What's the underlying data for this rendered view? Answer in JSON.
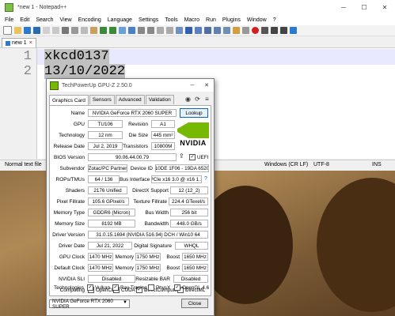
{
  "notepad": {
    "title": "*new 1 - Notepad++",
    "menu": [
      "File",
      "Edit",
      "Search",
      "View",
      "Encoding",
      "Language",
      "Settings",
      "Tools",
      "Macro",
      "Run",
      "Plugins",
      "Window",
      "?"
    ],
    "tab_label": "new 1",
    "tab_close": "×",
    "lines": [
      {
        "num": "1",
        "text": "xkcd0137"
      },
      {
        "num": "2",
        "text": "13/10/2022"
      }
    ],
    "status": {
      "left": "Normal text file",
      "eol": "Windows (CR LF)",
      "encoding": "UTF-8",
      "ins": "INS"
    }
  },
  "gpuz": {
    "title": "TechPowerUp GPU-Z 2.50.0",
    "tabs": [
      "Graphics Card",
      "Sensors",
      "Advanced",
      "Validation"
    ],
    "lookup": "Lookup",
    "rows": {
      "name": {
        "label": "Name",
        "value": "NVIDIA GeForce RTX 2060 SUPER"
      },
      "gpu": {
        "label": "GPU",
        "value": "TU106"
      },
      "revision": {
        "label": "Revision",
        "value": "A1"
      },
      "technology": {
        "label": "Technology",
        "value": "12 nm"
      },
      "die_size": {
        "label": "Die Size",
        "value": "445 mm²"
      },
      "release_date": {
        "label": "Release Date",
        "value": "Jul 2, 2019"
      },
      "transistors": {
        "label": "Transistors",
        "value": "10800M"
      },
      "bios": {
        "label": "BIOS Version",
        "value": "90.06.44.00.79"
      },
      "uefi": "UEFI",
      "subvendor": {
        "label": "Subvendor",
        "value": "Zotac/PC Partner"
      },
      "device_id": {
        "label": "Device ID",
        "value": "10DE 1F06 - 19DA 6520"
      },
      "rops": {
        "label": "ROPs/TMUs",
        "value": "64 / 136"
      },
      "bus_interface": {
        "label": "Bus Interface",
        "value": "PCIe x16 3.0 @ x16 1.1"
      },
      "bus_help": "?",
      "shaders": {
        "label": "Shaders",
        "value": "2176 Unified"
      },
      "directx": {
        "label": "DirectX Support",
        "value": "12 (12_2)"
      },
      "pixel_fillrate": {
        "label": "Pixel Fillrate",
        "value": "105.6 GPixel/s"
      },
      "texture_fillrate": {
        "label": "Texture Fillrate",
        "value": "224.4 GTexel/s"
      },
      "memory_type": {
        "label": "Memory Type",
        "value": "GDDR6 (Micron)"
      },
      "bus_width": {
        "label": "Bus Width",
        "value": "256 bit"
      },
      "memory_size": {
        "label": "Memory Size",
        "value": "8192 MB"
      },
      "bandwidth": {
        "label": "Bandwidth",
        "value": "448.0 GB/s"
      },
      "driver_version": {
        "label": "Driver Version",
        "value": "31.0.15.1694 (NVIDIA 516.94) DCH / Win10 64"
      },
      "driver_date": {
        "label": "Driver Date",
        "value": "Jul 21, 2022"
      },
      "digital_signature": {
        "label": "Digital Signature",
        "value": "WHQL"
      },
      "gpu_clock": {
        "label": "GPU Clock",
        "value": "1470 MHz",
        "mem_label": "Memory",
        "mem_value": "1750 MHz",
        "boost_label": "Boost",
        "boost_value": "1650 MHz"
      },
      "default_clock": {
        "label": "Default Clock",
        "value": "1470 MHz",
        "mem_label": "Memory",
        "mem_value": "1750 MHz",
        "boost_label": "Boost",
        "boost_value": "1650 MHz"
      },
      "nvidia_sli": {
        "label": "NVIDIA SLI",
        "value": "Disabled"
      },
      "resizable_bar": {
        "label": "Resizable BAR",
        "value": "Disabled"
      }
    },
    "computing": {
      "label": "Computing",
      "items": [
        "OpenCL",
        "CUDA",
        "DirectCompute",
        "DirectML"
      ]
    },
    "technologies": {
      "label": "Technologies",
      "items": [
        "Vulkan",
        "Ray Tracing",
        "PhysX",
        "OpenGL 4.6"
      ],
      "checked": [
        true,
        true,
        false,
        true
      ]
    },
    "selected_card": "NVIDIA GeForce RTX 2060 SUPER",
    "close": "Close",
    "nvidia_text": "NVIDIA"
  },
  "colors": {
    "nvidia_green": "#76b900",
    "accent_blue": "#0a64c8"
  }
}
